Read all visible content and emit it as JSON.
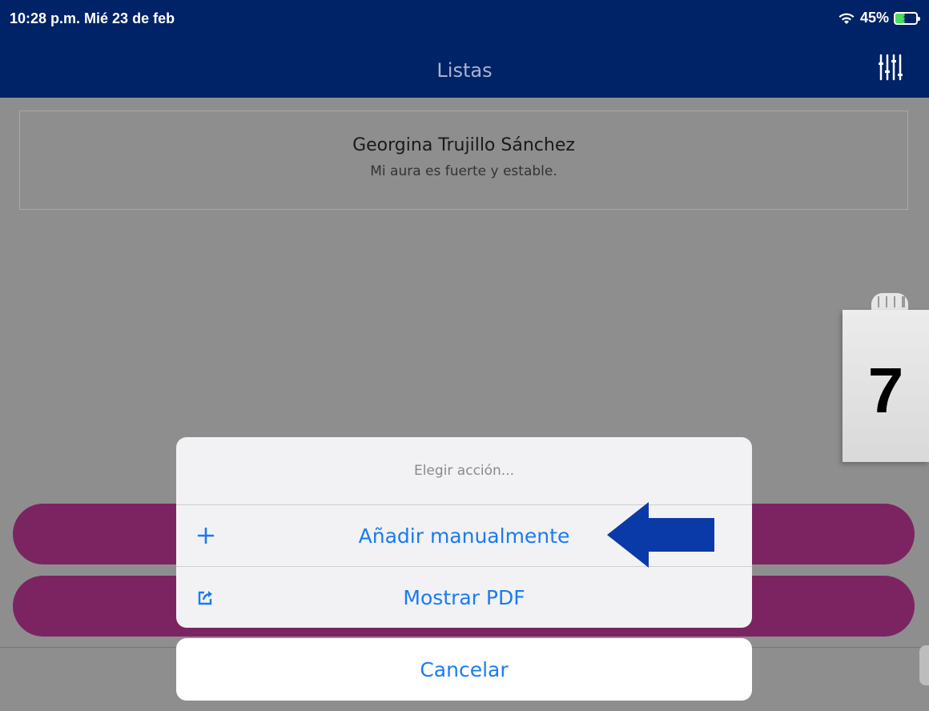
{
  "status_bar": {
    "time": "10:28 p.m.   Mié 23 de feb",
    "battery": "45%"
  },
  "nav": {
    "title": "Listas"
  },
  "profile": {
    "name": "Georgina Trujillo Sánchez",
    "subtitle": "Mi aura es fuerte y estable."
  },
  "sign": {
    "number": "7"
  },
  "action_sheet": {
    "title": "Elegir acción...",
    "items": [
      {
        "label": "Añadir manualmente",
        "icon": "plus-icon"
      },
      {
        "label": "Mostrar PDF",
        "icon": "share-icon"
      }
    ],
    "cancel_label": "Cancelar"
  },
  "colors": {
    "nav": "#002266",
    "accent": "#1a7bf2",
    "pill": "#7c2462",
    "arrow": "#0a3aa8"
  }
}
